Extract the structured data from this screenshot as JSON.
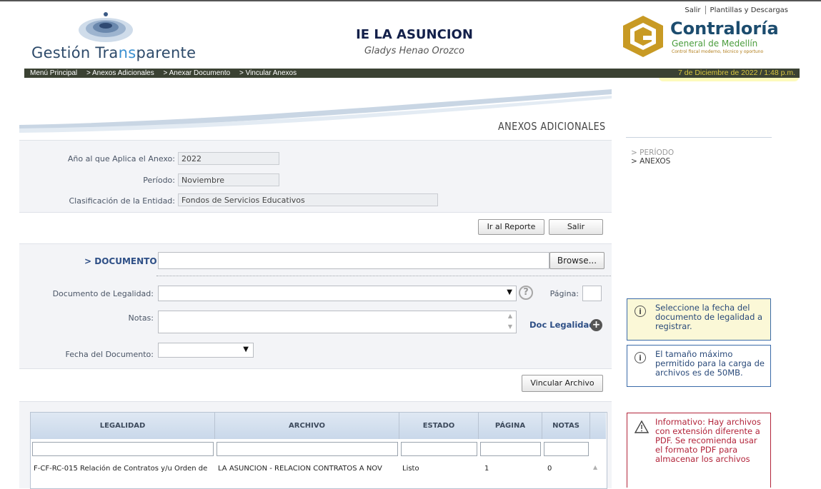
{
  "header": {
    "top_links": [
      "Salir",
      "Plantillas y Descargas"
    ],
    "brand_prefix": "Gestión Tra",
    "brand_highlight": "ns",
    "brand_suffix": "parente",
    "school": "IE LA ASUNCION",
    "person": "Gladys Henao Orozco",
    "contraloria_title": "Contraloría",
    "contraloria_sub": "General de Medellín",
    "contraloria_tag": "Control fiscal moderno, técnico y oportuno",
    "breadcrumbs": [
      "Menú Principal",
      "> Anexos Adicionales",
      "> Anexar Documento",
      "> Vincular Anexos"
    ],
    "datetime": "7 de Diciembre de 2022 / 1:48 p.m."
  },
  "main": {
    "section_title": "ANEXOS ADICIONALES",
    "fields": {
      "anio_label": "Año al que Aplica el Anexo:",
      "anio_value": "2022",
      "periodo_label": "Período:",
      "periodo_value": "Noviembre",
      "clasif_label": "Clasificación de la Entidad:",
      "clasif_value": "Fondos de Servicios Educativos"
    },
    "buttons": {
      "ir_reporte": "Ir al Reporte",
      "salir": "Salir",
      "browse": "Browse...",
      "vincular": "Vincular Archivo"
    },
    "documento_label": "> DOCUMENTO",
    "legalidad_label": "Documento de Legalidad:",
    "pagina_label": "Página:",
    "notas_label": "Notas:",
    "doc_legalidad_link": "Doc Legalidad",
    "fecha_label": "Fecha del Documento:"
  },
  "table": {
    "headers": [
      "LEGALIDAD",
      "ARCHIVO",
      "ESTADO",
      "PÁGINA",
      "NOTAS"
    ],
    "rows": [
      [
        "F-CF-RC-015 Relación de Contratos y/u Orden de",
        "LA ASUNCION - RELACION CONTRATOS A NOV",
        "Listo",
        "1",
        "0"
      ]
    ]
  },
  "sidebar": {
    "nav": [
      "> PERÍODO",
      "> ANEXOS"
    ],
    "info_fecha": "Seleccione la fecha del documento de legalidad a registrar.",
    "info_tamano": "El tamaño máximo permitido para la carga de archivos es de 50MB.",
    "info_pdf": "Informativo: Hay archivos con extensión diferente a PDF. Se recomienda usar el formato PDF para almacenar los archivos"
  }
}
